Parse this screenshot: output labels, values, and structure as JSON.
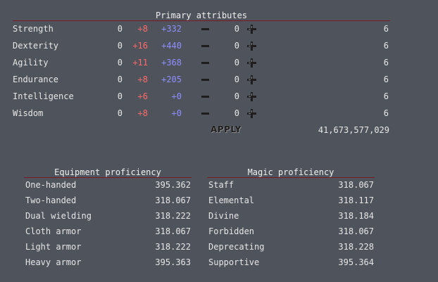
{
  "primary": {
    "title": "Primary attributes",
    "attributes": [
      {
        "name": "Strength",
        "base": "0",
        "bonus": "+8",
        "extra": "+332",
        "alloc": "0",
        "cost": "6"
      },
      {
        "name": "Dexterity",
        "base": "0",
        "bonus": "+16",
        "extra": "+440",
        "alloc": "0",
        "cost": "6"
      },
      {
        "name": "Agility",
        "base": "0",
        "bonus": "+11",
        "extra": "+368",
        "alloc": "0",
        "cost": "6"
      },
      {
        "name": "Endurance",
        "base": "0",
        "bonus": "+8",
        "extra": "+205",
        "alloc": "0",
        "cost": "6"
      },
      {
        "name": "Intelligence",
        "base": "0",
        "bonus": "+6",
        "extra": "+0",
        "alloc": "0",
        "cost": "6"
      },
      {
        "name": "Wisdom",
        "base": "0",
        "bonus": "+8",
        "extra": "+0",
        "alloc": "0",
        "cost": "6"
      }
    ],
    "apply_label": "APPLY",
    "gold": "41,673,577,029"
  },
  "equipment": {
    "title": "Equipment proficiency",
    "items": [
      {
        "name": "One-handed",
        "value": "395.362"
      },
      {
        "name": "Two-handed",
        "value": "318.067"
      },
      {
        "name": "Dual wielding",
        "value": "318.222"
      },
      {
        "name": "Cloth armor",
        "value": "318.067"
      },
      {
        "name": "Light armor",
        "value": "318.222"
      },
      {
        "name": "Heavy armor",
        "value": "395.363"
      }
    ]
  },
  "magic": {
    "title": "Magic proficiency",
    "items": [
      {
        "name": "Staff",
        "value": "318.067"
      },
      {
        "name": "Elemental",
        "value": "318.117"
      },
      {
        "name": "Divine",
        "value": "318.184"
      },
      {
        "name": "Forbidden",
        "value": "318.067"
      },
      {
        "name": "Deprecating",
        "value": "318.228"
      },
      {
        "name": "Supportive",
        "value": "395.364"
      }
    ]
  },
  "colors": {
    "background": "#4f535c",
    "bonus": "#ff6b6b",
    "extra": "#8f8fff",
    "divider": "#7a1a26"
  }
}
